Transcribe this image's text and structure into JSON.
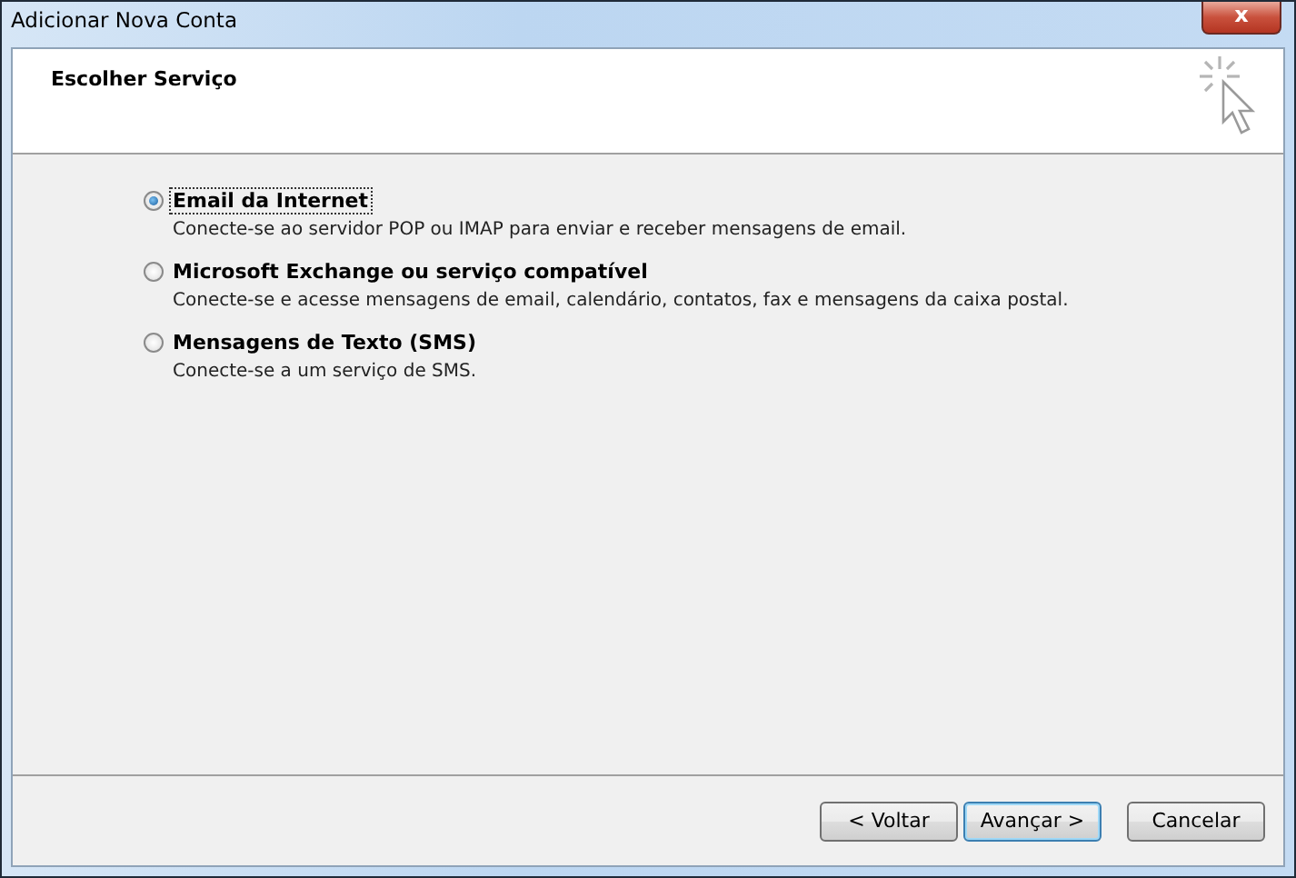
{
  "window": {
    "title": "Adicionar Nova Conta",
    "close": "x"
  },
  "header": {
    "title": "Escolher Serviço"
  },
  "options": [
    {
      "label": "Email da Internet",
      "description": "Conecte-se ao servidor POP ou IMAP para enviar e receber mensagens de email.",
      "selected": true
    },
    {
      "label": "Microsoft Exchange ou serviço compatível",
      "description": "Conecte-se e acesse mensagens de email, calendário, contatos, fax e mensagens da caixa postal.",
      "selected": false
    },
    {
      "label": "Mensagens de Texto (SMS)",
      "description": "Conecte-se a um serviço de SMS.",
      "selected": false
    }
  ],
  "buttons": [
    {
      "label": "< Voltar",
      "default": false
    },
    {
      "label": "Avançar >",
      "default": true
    },
    {
      "label": "Cancelar",
      "default": false
    }
  ]
}
